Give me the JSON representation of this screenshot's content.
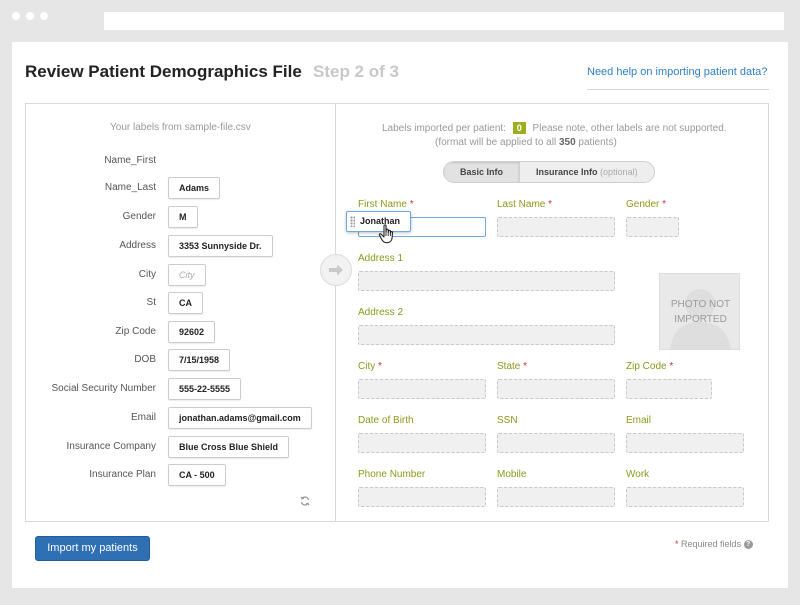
{
  "header": {
    "title": "Review Patient Demographics File",
    "step": "Step 2 of 3",
    "help_link": "Need help on importing patient data?"
  },
  "left": {
    "caption": "Your labels from sample-file.csv",
    "rows": [
      {
        "label": "Name_First",
        "value": ""
      },
      {
        "label": "Name_Last",
        "value": "Adams"
      },
      {
        "label": "Gender",
        "value": "M"
      },
      {
        "label": "Address",
        "value": "3353 Sunnyside Dr."
      },
      {
        "label": "City",
        "value": "City"
      },
      {
        "label": "St",
        "value": "CA"
      },
      {
        "label": "Zip Code",
        "value": "92602"
      },
      {
        "label": "DOB",
        "value": "7/15/1958"
      },
      {
        "label": "Social Security Number",
        "value": "555-22-5555"
      },
      {
        "label": "Email",
        "value": "jonathan.adams@gmail.com"
      },
      {
        "label": "Insurance Company",
        "value": "Blue Cross Blue Shield"
      },
      {
        "label": "Insurance Plan",
        "value": "CA - 500"
      }
    ]
  },
  "right": {
    "labels_prefix": "Labels imported per patient:",
    "labels_count": "0",
    "labels_suffix": "Please note, other labels are not supported.",
    "format_prefix": "(format will be applied to all",
    "patient_count": "350",
    "format_suffix": "patients)",
    "tabs": {
      "basic": "Basic Info",
      "insurance": "Insurance Info",
      "optional": "(optional)"
    },
    "fields": {
      "first_name": "First Name",
      "last_name": "Last Name",
      "gender": "Gender",
      "address1": "Address 1",
      "address2": "Address 2",
      "city": "City",
      "state": "State",
      "zip": "Zip Code",
      "dob": "Date of Birth",
      "ssn": "SSN",
      "email": "Email",
      "phone": "Phone Number",
      "mobile": "Mobile",
      "work": "Work"
    },
    "required_marker": "*",
    "dragging_value": "Jonathan",
    "photo_text": "PHOTO NOT IMPORTED"
  },
  "footer": {
    "import_button": "Import my patients",
    "required_marker": "*",
    "required_note": "Required fields",
    "help_glyph": "?"
  },
  "colors": {
    "accent": "#2f6fb3",
    "field_label": "#8a9a1a",
    "badge": "#9ab01e",
    "required": "#cc3333"
  }
}
